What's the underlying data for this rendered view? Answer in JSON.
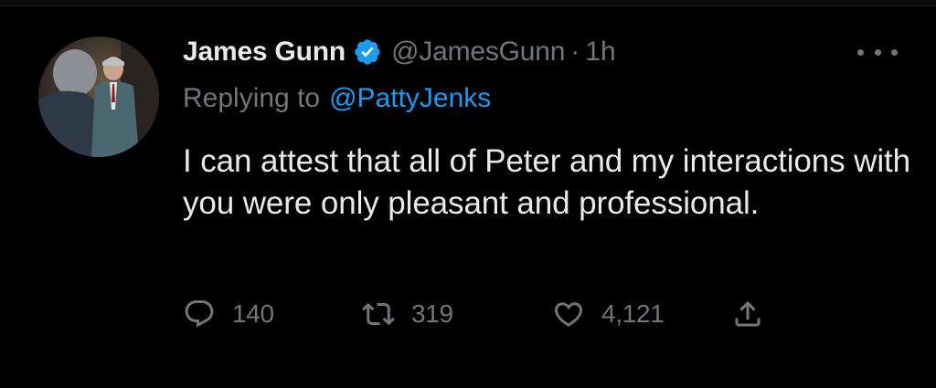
{
  "tweet": {
    "author_name": "James Gunn",
    "handle": "@JamesGunn",
    "separator": "·",
    "time": "1h",
    "verified": true,
    "reply_prefix": "Replying to",
    "reply_to": "@PattyJenks",
    "text": "I can attest that all of Peter and my interactions with you were only pleasant and professional.",
    "metrics": {
      "replies": "140",
      "retweets": "319",
      "likes": "4,121"
    }
  },
  "icons": {
    "verified": "verified-badge-icon",
    "more": "more-options-icon",
    "reply": "reply-icon",
    "retweet": "retweet-icon",
    "like": "heart-icon",
    "share": "share-icon"
  },
  "colors": {
    "background": "#000000",
    "primary_text": "#e7e9ea",
    "secondary_text": "#71767b",
    "accent": "#1d9bf0"
  }
}
